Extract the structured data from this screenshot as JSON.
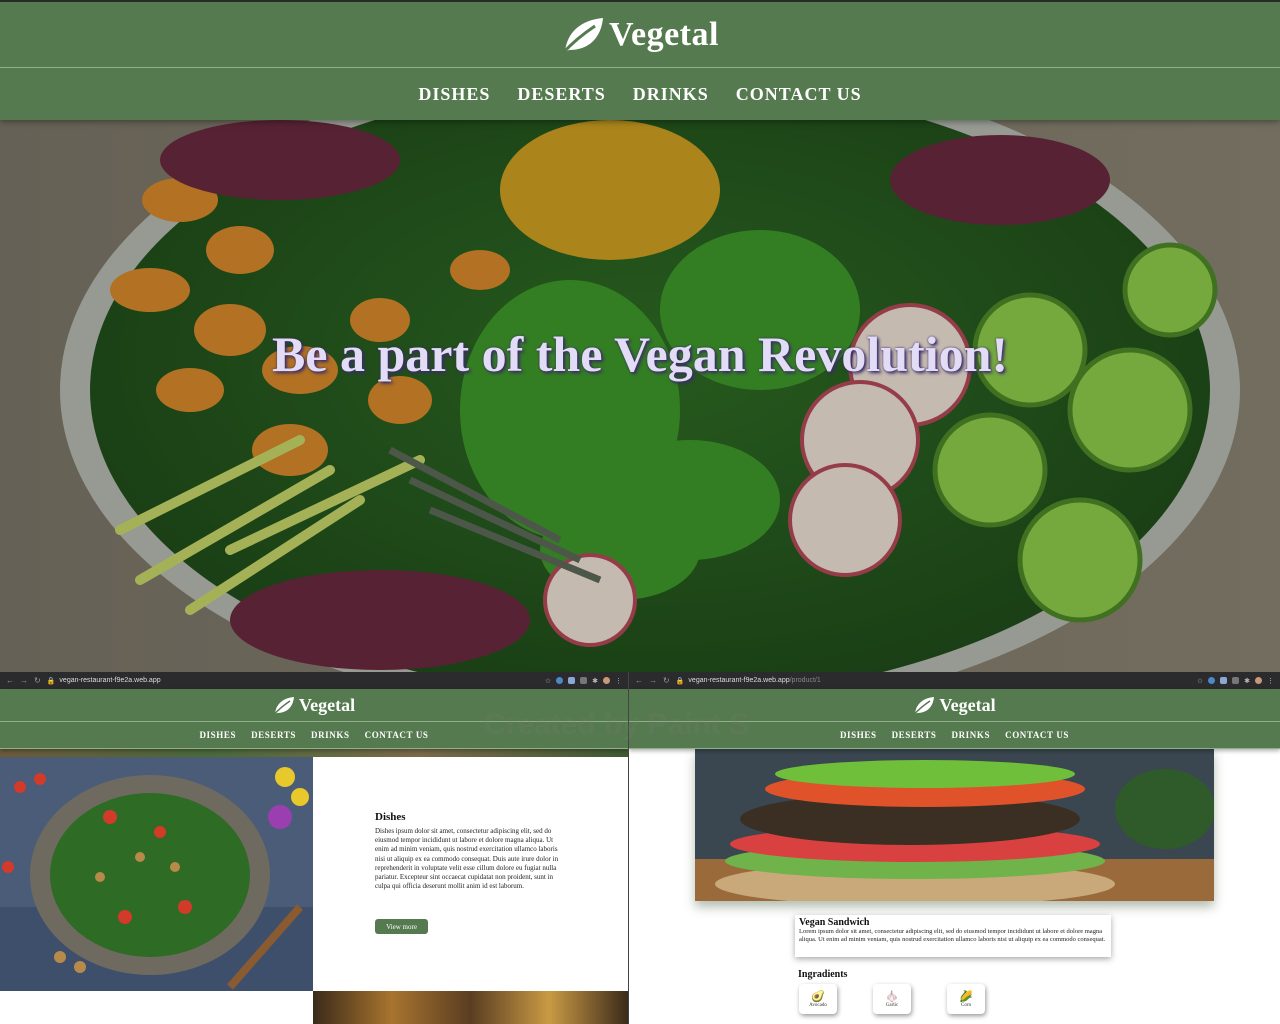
{
  "brand": {
    "name": "Vegetal"
  },
  "nav": {
    "items": [
      "DISHES",
      "DESERTS",
      "DRINKS",
      "CONTACT US"
    ]
  },
  "hero": {
    "title": "Be a part of the Vegan Revolution!"
  },
  "left_window": {
    "url": "vegan-restaurant-f9e2a.web.app",
    "section": {
      "title": "Dishes",
      "body": "Dishes ipsum dolor sit amet, consectetur adipiscing elit, sed do eiusmod tempor incididunt ut labore et dolore magna aliqua. Ut enim ad minim veniam, quis nostrud exercitation ullamco laboris nisi ut aliquip ex ea commodo consequat. Duis aute irure dolor in reprehenderit in voluptate velit esse cillum dolore eu fugiat nulla pariatur. Excepteur sint occaecat cupidatat non proident, sunt in culpa qui officia deserunt mollit anim id est laborum.",
      "button": "View more"
    }
  },
  "right_window": {
    "url_main": "vegan-restaurant-f9e2a.web.app",
    "url_path": "/product/1",
    "product": {
      "name": "Vegan Sandwich",
      "description": "Lorem ipsum dolor sit amet, consectetur adipiscing elit, sed do eiusmod tempor incididunt ut labore et dolore magna aliqua. Ut enim ad minim veniam, quis nostrud exercitation ullamco laboris nisi ut aliquip ex ea commodo consequat."
    },
    "ingredients_title": "Ingradients",
    "ingredients": [
      {
        "name": "Avocado",
        "icon": "avocado-icon"
      },
      {
        "name": "Garlic",
        "icon": "garlic-icon"
      },
      {
        "name": "Corn",
        "icon": "corn-icon"
      }
    ]
  },
  "watermark": "Created by Paint S",
  "colors": {
    "header_green": "#567a4f",
    "hero_title": "#e2dcf6",
    "title_shadow": "#3a2c66"
  }
}
